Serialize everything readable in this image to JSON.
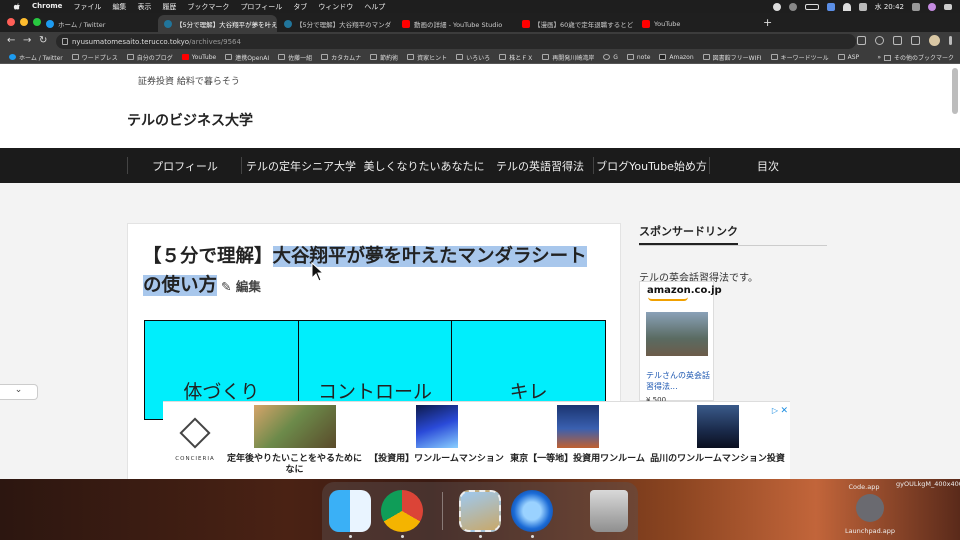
{
  "menubar": {
    "app": "Chrome",
    "items": [
      "ファイル",
      "編集",
      "表示",
      "履歴",
      "ブックマーク",
      "プロフィール",
      "タブ",
      "ウィンドウ",
      "ヘルプ"
    ],
    "clock": "水 20:42"
  },
  "tabs": [
    {
      "title": "ホーム / Twitter",
      "color": "#1d9bf0",
      "active": false
    },
    {
      "title": "【5分で理解】大谷翔平が夢を叶え",
      "color": "#21759b",
      "active": true
    },
    {
      "title": "【5分で理解】大谷翔平のマンダ",
      "color": "#21759b",
      "active": false
    },
    {
      "title": "動画の詳細 - YouTube Studio",
      "color": "#ff0000",
      "active": false
    },
    {
      "title": "【漫画】60歳で定年退職するとど",
      "color": "#ff0000",
      "active": false
    },
    {
      "title": "YouTube",
      "color": "#ff0000",
      "active": false
    }
  ],
  "address": {
    "host": "nyusumatomesaito.terucco.tokyo",
    "path": "/archives/9564"
  },
  "bookmarks": [
    "ホーム / Twitter",
    "ワードプレス",
    "自分のブログ",
    "YouTube",
    "連携OpenAI",
    "佐藤一組",
    "カタカムナ",
    "節約術",
    "資家ヒント",
    "いろいろ",
    "株とＦＸ",
    "再開発川崎湾岸",
    "G",
    "note",
    "Amazon",
    "図書館フリーWIFI",
    "キーワードツール",
    "ASP"
  ],
  "bookmarks_other": "その他のブックマーク",
  "page": {
    "top_text": "証券投資 給料で暮らそう",
    "site_title": "テルのビジネス大学",
    "nav": [
      "プロフィール",
      "テルの定年シニア大学",
      "美しくなりたいあなたに",
      "テルの英語習得法",
      "ブログYouTube始め方",
      "目次"
    ],
    "title_plain": "【５分で理解】",
    "title_highlighted": "大谷翔平が夢を叶えたマンダラシートの使い方",
    "edit": "編集",
    "mandala": [
      "体づくり",
      "コントロール",
      "キレ"
    ]
  },
  "sidebar": {
    "heading": "スポンサードリンク",
    "text": "テルの英会話習得法です。",
    "amazon": "amazon.co.jp",
    "book_link": "テルさんの英会話習得法...",
    "price": "¥ 500"
  },
  "ad": {
    "brand": "CONCIERIA",
    "items": [
      {
        "caption": "定年後やりたいことをやるためになに",
        "img": "forest"
      },
      {
        "caption": "【投資用】ワンルームマンション",
        "img": "night"
      },
      {
        "caption": "東京【一等地】投資用ワンルーム",
        "img": "tower"
      },
      {
        "caption": "品川のワンルームマンション投資",
        "img": "city"
      }
    ]
  },
  "desktop": {
    "files": [
      "Code.app",
      "gyOULkgM_400x400.jpg",
      "Launchpad.app"
    ]
  }
}
